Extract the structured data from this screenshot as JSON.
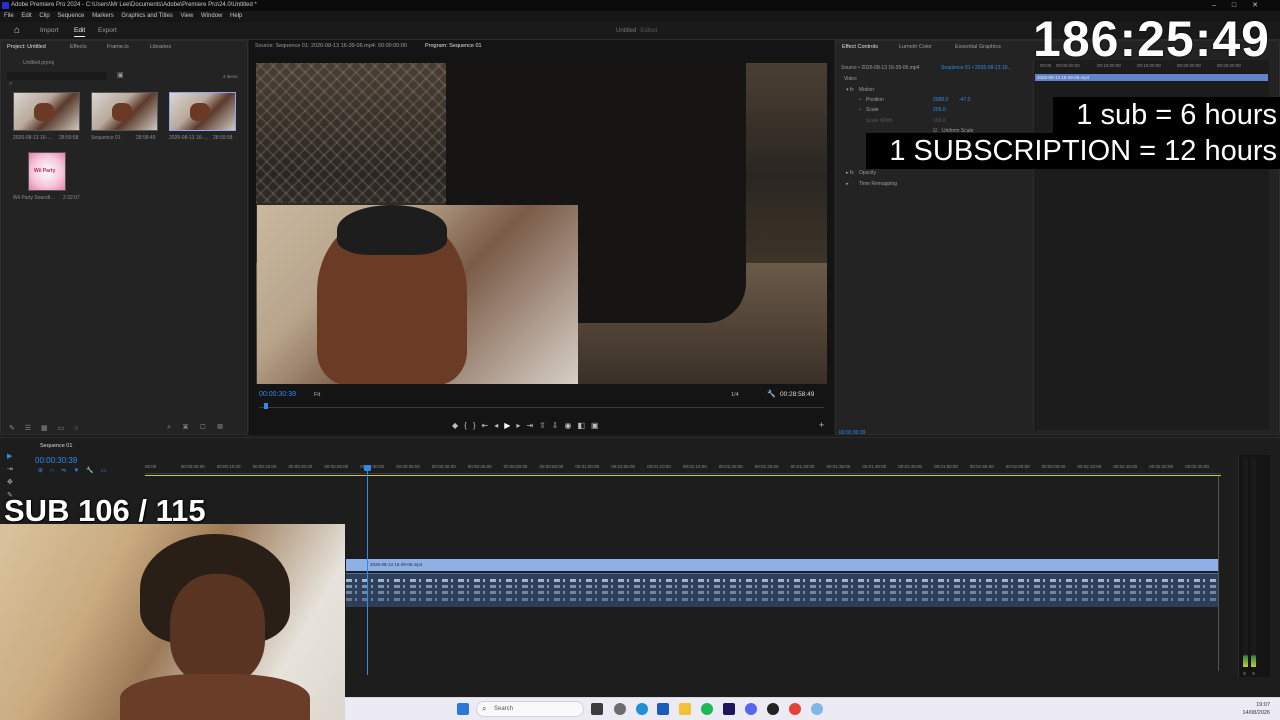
{
  "window": {
    "title": "Adobe Premiere Pro 2024 - C:\\Users\\Mr Lee\\Documents\\Adobe\\Premiere Pro\\24.0\\Untitled *"
  },
  "menu": [
    "File",
    "Edit",
    "Clip",
    "Sequence",
    "Markers",
    "Graphics and Titles",
    "View",
    "Window",
    "Help"
  ],
  "workspace": {
    "tabs": [
      "Import",
      "Edit",
      "Export"
    ],
    "active": "Edit",
    "project_name": "Untitled",
    "status": "Edited"
  },
  "project_panel": {
    "tabs": [
      "Project: Untitled",
      "Effects",
      "Frame.io",
      "Libraries"
    ],
    "file": "Untitled.prproj",
    "item_count": "4 items",
    "items": [
      {
        "name": "2026-08-13 16-…",
        "duration": "28:59:58"
      },
      {
        "name": "Sequence 01",
        "duration": "28:58:49"
      },
      {
        "name": "2026-08-13 16-…",
        "duration": "28:59:58"
      },
      {
        "name": "Wii Party Soundt…",
        "duration": "2:32:07"
      }
    ],
    "thumb4_text": "Wii Party"
  },
  "monitor": {
    "source_tab": "Source: Sequence 01: 2026-08-13 16-39-06.mp4: 00:00:00:00",
    "program_tab": "Program: Sequence 01",
    "current_tc": "00:00:30:39",
    "fit": "Fit",
    "fraction": "1/4",
    "duration": "00:28:58:49"
  },
  "effect_controls": {
    "tabs": [
      "Effect Controls",
      "Lumetri Color",
      "Essential Graphics"
    ],
    "source": "Source • 2026-08-13 16-39-06.mp4",
    "sequence": "Sequence 01 • 2026-08-13 16...",
    "section": "Video",
    "motion": "Motion",
    "position_label": "Position",
    "position_x": "2088.0",
    "position_y": "-47.0",
    "scale_label": "Scale",
    "scale_value": "209.0",
    "scale_width_label": "Scale Width",
    "scale_width_value": "100.0",
    "uniform_scale": "Uniform Scale",
    "opacity": "Opacity",
    "time_remap": "Time Remapping",
    "clip_name": "2026-08-13 16-39-06.mp4",
    "ruler": [
      "00:00",
      "00:05:00:00",
      "00:10:00:00",
      "00:15:00:00",
      "00:20:00:00",
      "00:25:00:00"
    ],
    "footer_tc": "00:00:30:39"
  },
  "timeline": {
    "sequence_tab": "Sequence 01",
    "current_tc": "00:00:30:39",
    "ruler": [
      "00:00",
      "00:00:05:00",
      "00:00:10:00",
      "00:00:15:00",
      "00:00:20:00",
      "00:00:25:00",
      "00:00:30:00",
      "00:00:35:00",
      "00:00:40:00",
      "00:00:45:00",
      "00:00:50:00",
      "00:00:55:00",
      "00:01:00:00",
      "00:01:05:00",
      "00:01:10:00",
      "00:01:15:00",
      "00:01:20:00",
      "00:01:25:00",
      "00:01:30:00",
      "00:01:35:00",
      "00:01:40:00",
      "00:01:45:00",
      "00:01:50:00",
      "00:01:55:00",
      "00:02:00:00",
      "00:02:05:00",
      "00:02:10:00",
      "00:02:15:00",
      "00:02:20:00",
      "00:02:25:00"
    ],
    "clip_name": "2026-08-13 16-39-06.mp4",
    "meter_labels": [
      "S",
      "S"
    ]
  },
  "overlay": {
    "timer": "186:25:49",
    "sub_rule": "1 sub = 6 hours",
    "subscription_rule": "1 SUBSCRIPTION = 12 hours",
    "sub_count": "SUB 106 / 115"
  },
  "taskbar": {
    "search_placeholder": "Search",
    "time": "19:07",
    "date": "14/08/2026"
  }
}
